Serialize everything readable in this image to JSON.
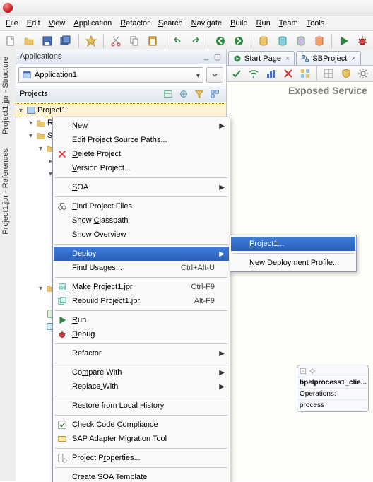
{
  "menubar": {
    "items": [
      {
        "label": "File",
        "u": 0
      },
      {
        "label": "Edit",
        "u": 0
      },
      {
        "label": "View",
        "u": 0
      },
      {
        "label": "Application",
        "u": 0
      },
      {
        "label": "Refactor",
        "u": 0
      },
      {
        "label": "Search",
        "u": 0
      },
      {
        "label": "Navigate",
        "u": 0
      },
      {
        "label": "Build",
        "u": 0
      },
      {
        "label": "Run",
        "u": 0
      },
      {
        "label": "Team",
        "u": 0
      },
      {
        "label": "Tools",
        "u": 0
      }
    ]
  },
  "apps_panel": {
    "title": "Applications",
    "combo": "Application1",
    "projects_label": "Projects"
  },
  "tree": {
    "root": "Project1",
    "nodes": [
      "Res",
      "SOA"
    ]
  },
  "leftbar": {
    "tabs": [
      "Project1.jpr - Structure",
      "Project1.jpr - References"
    ]
  },
  "editor": {
    "tabs": [
      {
        "label": "Start Page"
      },
      {
        "label": "SBProject"
      }
    ],
    "exposed_label": "Exposed Service",
    "node": {
      "title": "bpelprocess1_clie...",
      "row1": "Operations:",
      "row2": "process"
    }
  },
  "context_menu": {
    "items": [
      {
        "label": "New",
        "u": 0,
        "sub": true
      },
      {
        "label": "Edit Project Source Paths..."
      },
      {
        "label": "Delete Project",
        "u": 0,
        "icon": "delete"
      },
      {
        "label": "Version Project...",
        "u": 0
      },
      {
        "sep": true
      },
      {
        "label": "SOA",
        "u": 0,
        "sub": true
      },
      {
        "sep": true
      },
      {
        "label": "Find Project Files",
        "u": 0,
        "icon": "binoc"
      },
      {
        "label": "Show Classpath",
        "u": 5
      },
      {
        "label": "Show Overview"
      },
      {
        "sep": true
      },
      {
        "label": "Deploy",
        "u": 3,
        "sub": true,
        "hot": true
      },
      {
        "label": "Find Usages...",
        "accel": "Ctrl+Alt-U"
      },
      {
        "sep": true
      },
      {
        "label": "Make Project1.jpr",
        "u": 0,
        "icon": "make",
        "accel": "Ctrl-F9"
      },
      {
        "label": "Rebuild Project1.jpr",
        "icon": "rebuild",
        "accel": "Alt-F9"
      },
      {
        "sep": true
      },
      {
        "label": "Run",
        "u": 0,
        "icon": "run"
      },
      {
        "label": "Debug",
        "u": 0,
        "icon": "debug"
      },
      {
        "sep": true
      },
      {
        "label": "Refactor",
        "sub": true
      },
      {
        "sep": true
      },
      {
        "label": "Compare With",
        "u": 2,
        "sub": true
      },
      {
        "label": "Replace With",
        "u": 7,
        "sub": true
      },
      {
        "sep": true
      },
      {
        "label": "Restore from Local History"
      },
      {
        "sep": true
      },
      {
        "label": "Check Code Compliance",
        "icon": "check"
      },
      {
        "label": "SAP Adapter Migration Tool",
        "icon": "sap"
      },
      {
        "sep": true
      },
      {
        "label": "Project Properties...",
        "u": 9,
        "icon": "props"
      },
      {
        "sep": true
      },
      {
        "label": "Create SOA Template"
      }
    ]
  },
  "deploy_submenu": {
    "items": [
      {
        "label": "Project1...",
        "u": 0,
        "hot": true
      },
      {
        "sep": true
      },
      {
        "label": "New Deployment Profile...",
        "u": 0
      }
    ]
  }
}
